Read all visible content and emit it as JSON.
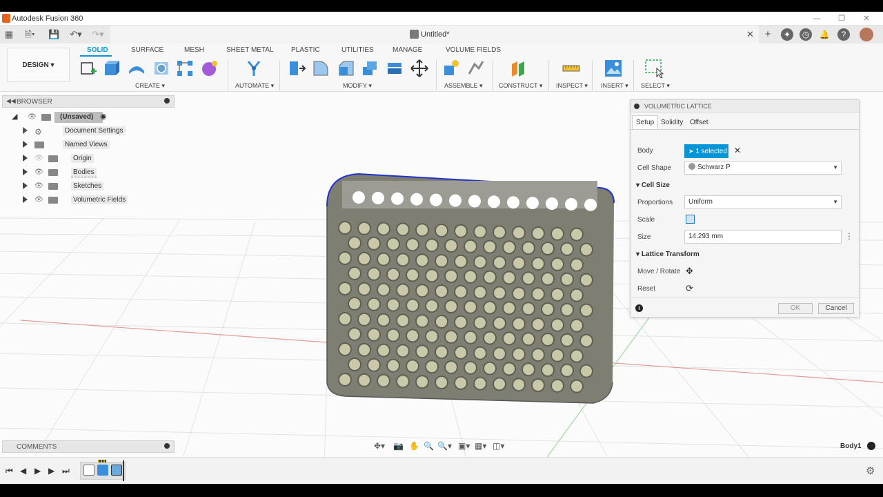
{
  "app": {
    "title": "Autodesk Fusion 360"
  },
  "document": {
    "title": "Untitled*"
  },
  "ribbon": {
    "workspace": "DESIGN",
    "tabs": [
      "SOLID",
      "SURFACE",
      "MESH",
      "SHEET METAL",
      "PLASTIC",
      "UTILITIES",
      "MANAGE",
      "VOLUME FIELDS"
    ],
    "active_tab": "SOLID",
    "groups": [
      "CREATE",
      "AUTOMATE",
      "MODIFY",
      "ASSEMBLE",
      "CONSTRUCT",
      "INSPECT",
      "INSERT",
      "SELECT"
    ]
  },
  "browser": {
    "title": "BROWSER",
    "root": "(Unsaved)",
    "items": [
      "Document Settings",
      "Named Views",
      "Origin",
      "Bodies",
      "Sketches",
      "Volumetric Fields"
    ]
  },
  "dialog": {
    "title": "VOLUMETRIC LATTICE",
    "tabs": [
      "Setup",
      "Solidity",
      "Offset"
    ],
    "active_tab": "Setup",
    "body_label": "Body",
    "body_value": "1 selected",
    "cell_shape_label": "Cell Shape",
    "cell_shape_value": "Schwarz P",
    "cell_size_section": "Cell Size",
    "proportions_label": "Proportions",
    "proportions_value": "Uniform",
    "scale_label": "Scale",
    "size_label": "Size",
    "size_value": "14.293 mm",
    "transform_section": "Lattice Transform",
    "move_rotate_label": "Move / Rotate",
    "reset_label": "Reset",
    "ok_label": "OK",
    "cancel_label": "Cancel"
  },
  "comments": {
    "title": "COMMENTS"
  },
  "status": {
    "body_name": "Body1"
  },
  "colors": {
    "accent": "#0696d7",
    "brand": "#e8611a"
  }
}
